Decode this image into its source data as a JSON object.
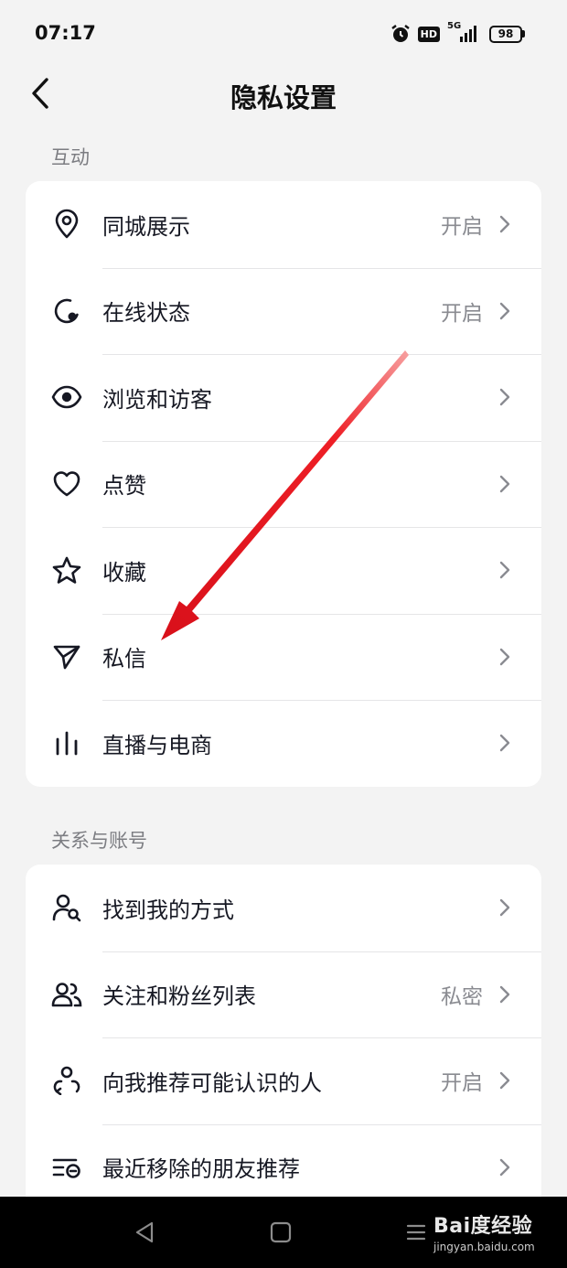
{
  "status_bar": {
    "time": "07:17",
    "hd": "HD",
    "network": "5G",
    "battery": "98"
  },
  "header": {
    "title": "隐私设置"
  },
  "sections": [
    {
      "title": "互动",
      "items": [
        {
          "icon": "location-pin-icon",
          "label": "同城展示",
          "value": "开启"
        },
        {
          "icon": "online-status-icon",
          "label": "在线状态",
          "value": "开启"
        },
        {
          "icon": "eye-icon",
          "label": "浏览和访客",
          "value": ""
        },
        {
          "icon": "heart-icon",
          "label": "点赞",
          "value": ""
        },
        {
          "icon": "star-icon",
          "label": "收藏",
          "value": ""
        },
        {
          "icon": "paper-plane-icon",
          "label": "私信",
          "value": ""
        },
        {
          "icon": "live-commerce-icon",
          "label": "直播与电商",
          "value": ""
        }
      ]
    },
    {
      "title": "关系与账号",
      "items": [
        {
          "icon": "find-person-icon",
          "label": "找到我的方式",
          "value": ""
        },
        {
          "icon": "users-icon",
          "label": "关注和粉丝列表",
          "value": "私密"
        },
        {
          "icon": "recommend-person-icon",
          "label": "向我推荐可能认识的人",
          "value": "开启"
        },
        {
          "icon": "removed-list-icon",
          "label": "最近移除的朋友推荐",
          "value": ""
        }
      ]
    }
  ],
  "watermark": {
    "logo": "Bai度经验",
    "url": "jingyan.baidu.com"
  },
  "colors": {
    "background": "#f3f3f3",
    "card": "#ffffff",
    "text": "#161823",
    "secondary_text": "#8a8b91",
    "annotation_arrow": "#e8141b"
  }
}
